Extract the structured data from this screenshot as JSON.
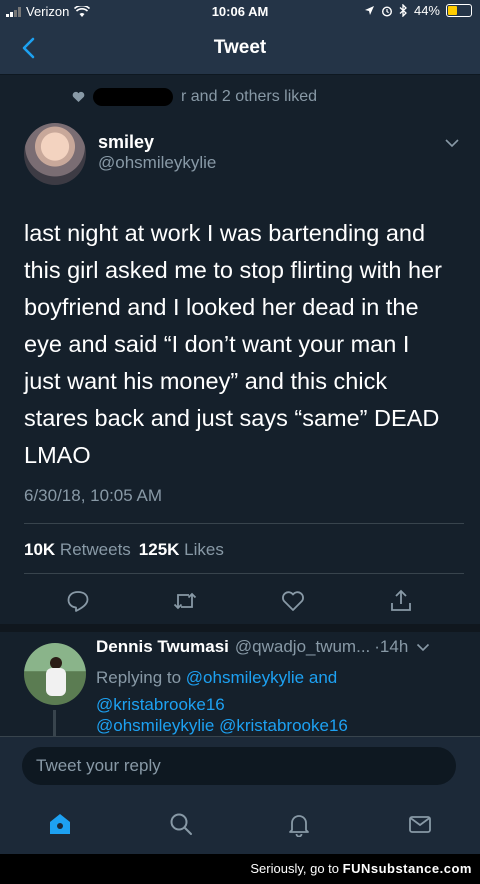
{
  "status_bar": {
    "carrier": "Verizon",
    "time": "10:06 AM",
    "battery": "44%",
    "battery_level": 0.44,
    "battery_color": "#ffcc00"
  },
  "nav": {
    "title": "Tweet",
    "back_icon": "chevron-left-icon"
  },
  "social_context": {
    "text": "r and 2 others liked",
    "icon": "heart-icon"
  },
  "tweet": {
    "author_name": "smiley",
    "author_handle": "@ohsmileykylie",
    "text": "last night at work I was bartending and\nthis girl asked me to stop flirting with her\nboyfriend and I looked her dead in the\neye and said “I don’t want your man I\njust want his money” and this chick\nstares back and just says “same” DEAD\nLMAO",
    "timestamp": "6/30/18, 10:05 AM",
    "retweets_count": "10K",
    "retweets_label": "Retweets",
    "likes_count": "125K",
    "likes_label": "Likes"
  },
  "actions": [
    "reply-icon",
    "retweet-icon",
    "heart-icon",
    "share-icon"
  ],
  "reply": {
    "author_name": "Dennis Twumasi",
    "author_handle": "@qwadjo_twum...",
    "time": "·14h",
    "replying_prefix": "Replying to",
    "replying_mention_1": "@ohsmileykylie",
    "replying_and": "and",
    "replying_mention_2": "@kristabrooke16",
    "body_mention_1": "@ohsmileykylie",
    "body_mention_2": "@kristabrooke16"
  },
  "composer": {
    "placeholder": "Tweet your reply"
  },
  "tabbar": [
    "home-icon",
    "search-icon",
    "notifications-icon",
    "messages-icon"
  ],
  "watermark": {
    "prefix": "Seriously, go to",
    "brand": "FUNsubstance.com"
  },
  "colors": {
    "background": "#15202b",
    "accent": "#1da1f2",
    "secondary_text": "#8899a6"
  }
}
